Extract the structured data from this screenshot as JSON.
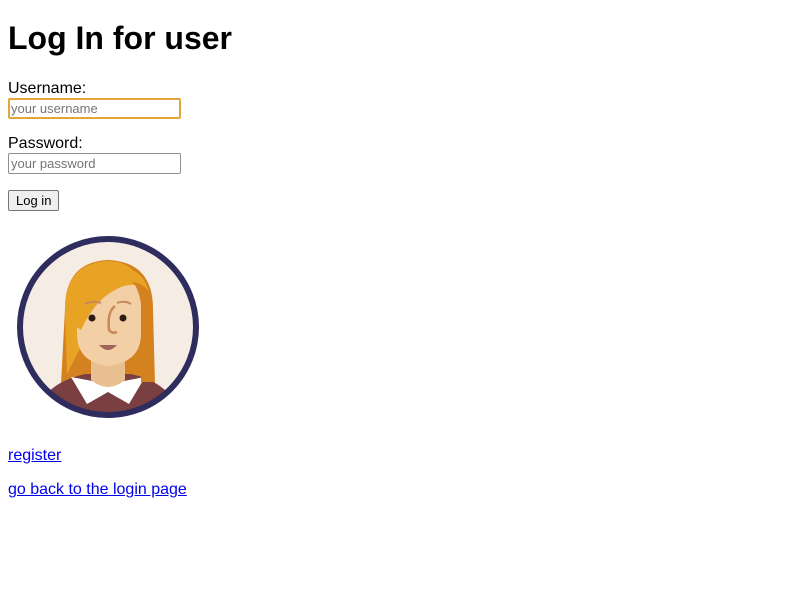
{
  "page": {
    "title": "Log In for user"
  },
  "form": {
    "username_label": "Username:",
    "username_placeholder": "your username",
    "username_value": "",
    "password_label": "Password:",
    "password_placeholder": "your password",
    "password_value": "",
    "submit_label": "Log in"
  },
  "avatar": {
    "icon": "user-avatar-icon",
    "ring_color": "#2e2d5e",
    "background_color": "#f5ede4",
    "hair_color": "#e8a325",
    "skin_color": "#f3cfa6",
    "shirt_color": "#7a3f40"
  },
  "links": {
    "register": "register",
    "back_to_login": "go back to the login page"
  },
  "colors": {
    "link": "#0000ee",
    "focus_border": "#e3a639"
  }
}
